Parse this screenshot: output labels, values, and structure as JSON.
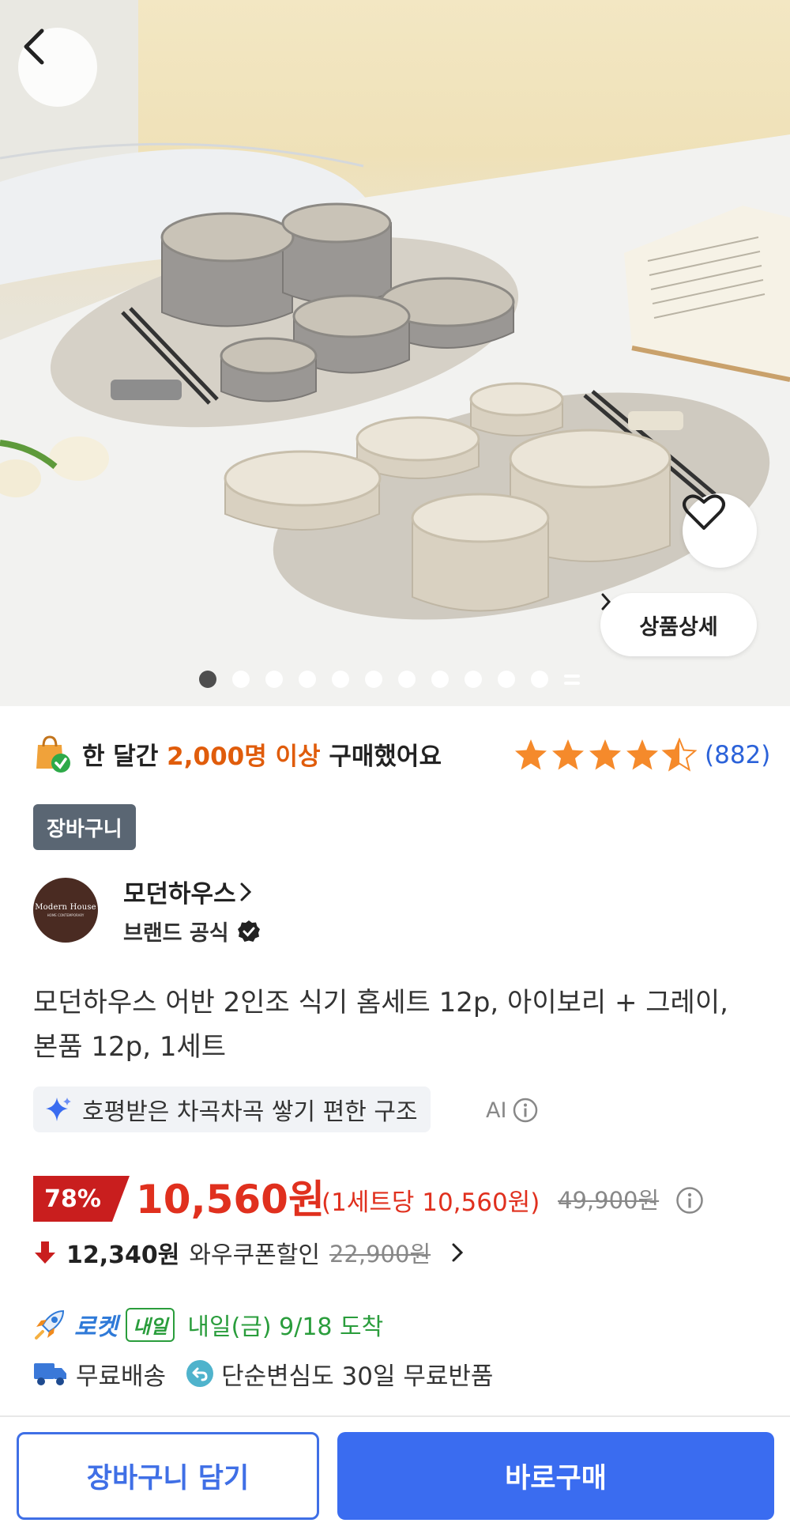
{
  "hero": {
    "image_alt": "product-photo-dinnerware-set",
    "detail_button_label": "상품상세",
    "carousel": {
      "total_dots": 11,
      "active_index": 0
    }
  },
  "social_proof": {
    "prefix": "한 달간 ",
    "highlight": "2,000명 이상",
    "suffix": " 구매했어요"
  },
  "rating": {
    "stars": 4.5,
    "max": 5,
    "count_label": "(882)"
  },
  "cart_badge": "장바구니",
  "brand": {
    "logo_line1": "Modern House",
    "logo_line2": "HOME CONTEMPORARY",
    "name": "모던하우스",
    "official_label": "브랜드 공식"
  },
  "product": {
    "title": "모던하우스 어반 2인조 식기 홈세트 12p, 아이보리 + 그레이, 본품 12p, 1세트"
  },
  "ai_summary": {
    "text": "호평받은 차곡차곡 쌓기 편한 구조",
    "label": "AI"
  },
  "price": {
    "discount": "78%",
    "sale": "10,560원",
    "unit": "(1세트당 10,560원)",
    "original": "49,900원"
  },
  "coupon": {
    "price": "12,340원",
    "label": "와우쿠폰할인",
    "original": "22,900원"
  },
  "delivery": {
    "rocket_label": "로켓",
    "badge": "내일",
    "arrival": "내일(금) 9/18 도착",
    "shipping": "무료배송",
    "returns": "단순변심도 30일 무료반품"
  },
  "actions": {
    "add_to_cart": "장바구니 담기",
    "buy_now": "바로구매"
  },
  "colors": {
    "accent_blue": "#3a6cf0",
    "price_red": "#e0301e",
    "highlight_orange": "#e05c0b",
    "star_orange": "#f58a2b",
    "rocket_green": "#2a9d3c"
  }
}
